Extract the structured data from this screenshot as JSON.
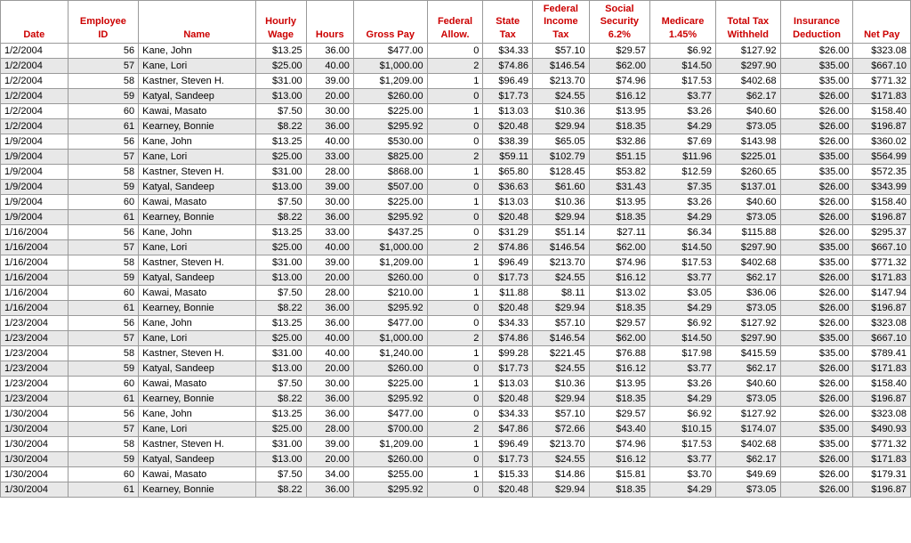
{
  "table": {
    "headers": [
      {
        "id": "date",
        "lines": [
          "Date"
        ],
        "align": "left"
      },
      {
        "id": "emp_id",
        "lines": [
          "Employee",
          "ID"
        ],
        "align": "right"
      },
      {
        "id": "name",
        "lines": [
          "Name"
        ],
        "align": "left"
      },
      {
        "id": "hourly_wage",
        "lines": [
          "Hourly",
          "Wage"
        ],
        "align": "right"
      },
      {
        "id": "hours",
        "lines": [
          "Hours"
        ],
        "align": "right"
      },
      {
        "id": "gross_pay",
        "lines": [
          "Gross Pay"
        ],
        "align": "right"
      },
      {
        "id": "fed_allow",
        "lines": [
          "Federal",
          "Allow."
        ],
        "align": "right"
      },
      {
        "id": "state_tax",
        "lines": [
          "State",
          "Tax"
        ],
        "align": "right"
      },
      {
        "id": "fed_income_tax",
        "lines": [
          "Federal",
          "Income",
          "Tax"
        ],
        "align": "right"
      },
      {
        "id": "social_security",
        "lines": [
          "Social",
          "Security",
          "6.2%"
        ],
        "align": "right"
      },
      {
        "id": "medicare",
        "lines": [
          "Medicare",
          "1.45%"
        ],
        "align": "right"
      },
      {
        "id": "total_tax_withheld",
        "lines": [
          "Total Tax",
          "Withheld"
        ],
        "align": "right"
      },
      {
        "id": "insurance_deduction",
        "lines": [
          "Insurance",
          "Deduction"
        ],
        "align": "right"
      },
      {
        "id": "net_pay",
        "lines": [
          "Net Pay"
        ],
        "align": "right"
      }
    ],
    "rows": [
      [
        "1/2/2004",
        "56",
        "Kane, John",
        "$13.25",
        "36.00",
        "$477.00",
        "0",
        "$34.33",
        "$57.10",
        "$29.57",
        "$6.92",
        "$127.92",
        "$26.00",
        "$323.08"
      ],
      [
        "1/2/2004",
        "57",
        "Kane, Lori",
        "$25.00",
        "40.00",
        "$1,000.00",
        "2",
        "$74.86",
        "$146.54",
        "$62.00",
        "$14.50",
        "$297.90",
        "$35.00",
        "$667.10"
      ],
      [
        "1/2/2004",
        "58",
        "Kastner, Steven H.",
        "$31.00",
        "39.00",
        "$1,209.00",
        "1",
        "$96.49",
        "$213.70",
        "$74.96",
        "$17.53",
        "$402.68",
        "$35.00",
        "$771.32"
      ],
      [
        "1/2/2004",
        "59",
        "Katyal, Sandeep",
        "$13.00",
        "20.00",
        "$260.00",
        "0",
        "$17.73",
        "$24.55",
        "$16.12",
        "$3.77",
        "$62.17",
        "$26.00",
        "$171.83"
      ],
      [
        "1/2/2004",
        "60",
        "Kawai, Masato",
        "$7.50",
        "30.00",
        "$225.00",
        "1",
        "$13.03",
        "$10.36",
        "$13.95",
        "$3.26",
        "$40.60",
        "$26.00",
        "$158.40"
      ],
      [
        "1/2/2004",
        "61",
        "Kearney, Bonnie",
        "$8.22",
        "36.00",
        "$295.92",
        "0",
        "$20.48",
        "$29.94",
        "$18.35",
        "$4.29",
        "$73.05",
        "$26.00",
        "$196.87"
      ],
      [
        "1/9/2004",
        "56",
        "Kane, John",
        "$13.25",
        "40.00",
        "$530.00",
        "0",
        "$38.39",
        "$65.05",
        "$32.86",
        "$7.69",
        "$143.98",
        "$26.00",
        "$360.02"
      ],
      [
        "1/9/2004",
        "57",
        "Kane, Lori",
        "$25.00",
        "33.00",
        "$825.00",
        "2",
        "$59.11",
        "$102.79",
        "$51.15",
        "$11.96",
        "$225.01",
        "$35.00",
        "$564.99"
      ],
      [
        "1/9/2004",
        "58",
        "Kastner, Steven H.",
        "$31.00",
        "28.00",
        "$868.00",
        "1",
        "$65.80",
        "$128.45",
        "$53.82",
        "$12.59",
        "$260.65",
        "$35.00",
        "$572.35"
      ],
      [
        "1/9/2004",
        "59",
        "Katyal, Sandeep",
        "$13.00",
        "39.00",
        "$507.00",
        "0",
        "$36.63",
        "$61.60",
        "$31.43",
        "$7.35",
        "$137.01",
        "$26.00",
        "$343.99"
      ],
      [
        "1/9/2004",
        "60",
        "Kawai, Masato",
        "$7.50",
        "30.00",
        "$225.00",
        "1",
        "$13.03",
        "$10.36",
        "$13.95",
        "$3.26",
        "$40.60",
        "$26.00",
        "$158.40"
      ],
      [
        "1/9/2004",
        "61",
        "Kearney, Bonnie",
        "$8.22",
        "36.00",
        "$295.92",
        "0",
        "$20.48",
        "$29.94",
        "$18.35",
        "$4.29",
        "$73.05",
        "$26.00",
        "$196.87"
      ],
      [
        "1/16/2004",
        "56",
        "Kane, John",
        "$13.25",
        "33.00",
        "$437.25",
        "0",
        "$31.29",
        "$51.14",
        "$27.11",
        "$6.34",
        "$115.88",
        "$26.00",
        "$295.37"
      ],
      [
        "1/16/2004",
        "57",
        "Kane, Lori",
        "$25.00",
        "40.00",
        "$1,000.00",
        "2",
        "$74.86",
        "$146.54",
        "$62.00",
        "$14.50",
        "$297.90",
        "$35.00",
        "$667.10"
      ],
      [
        "1/16/2004",
        "58",
        "Kastner, Steven H.",
        "$31.00",
        "39.00",
        "$1,209.00",
        "1",
        "$96.49",
        "$213.70",
        "$74.96",
        "$17.53",
        "$402.68",
        "$35.00",
        "$771.32"
      ],
      [
        "1/16/2004",
        "59",
        "Katyal, Sandeep",
        "$13.00",
        "20.00",
        "$260.00",
        "0",
        "$17.73",
        "$24.55",
        "$16.12",
        "$3.77",
        "$62.17",
        "$26.00",
        "$171.83"
      ],
      [
        "1/16/2004",
        "60",
        "Kawai, Masato",
        "$7.50",
        "28.00",
        "$210.00",
        "1",
        "$11.88",
        "$8.11",
        "$13.02",
        "$3.05",
        "$36.06",
        "$26.00",
        "$147.94"
      ],
      [
        "1/16/2004",
        "61",
        "Kearney, Bonnie",
        "$8.22",
        "36.00",
        "$295.92",
        "0",
        "$20.48",
        "$29.94",
        "$18.35",
        "$4.29",
        "$73.05",
        "$26.00",
        "$196.87"
      ],
      [
        "1/23/2004",
        "56",
        "Kane, John",
        "$13.25",
        "36.00",
        "$477.00",
        "0",
        "$34.33",
        "$57.10",
        "$29.57",
        "$6.92",
        "$127.92",
        "$26.00",
        "$323.08"
      ],
      [
        "1/23/2004",
        "57",
        "Kane, Lori",
        "$25.00",
        "40.00",
        "$1,000.00",
        "2",
        "$74.86",
        "$146.54",
        "$62.00",
        "$14.50",
        "$297.90",
        "$35.00",
        "$667.10"
      ],
      [
        "1/23/2004",
        "58",
        "Kastner, Steven H.",
        "$31.00",
        "40.00",
        "$1,240.00",
        "1",
        "$99.28",
        "$221.45",
        "$76.88",
        "$17.98",
        "$415.59",
        "$35.00",
        "$789.41"
      ],
      [
        "1/23/2004",
        "59",
        "Katyal, Sandeep",
        "$13.00",
        "20.00",
        "$260.00",
        "0",
        "$17.73",
        "$24.55",
        "$16.12",
        "$3.77",
        "$62.17",
        "$26.00",
        "$171.83"
      ],
      [
        "1/23/2004",
        "60",
        "Kawai, Masato",
        "$7.50",
        "30.00",
        "$225.00",
        "1",
        "$13.03",
        "$10.36",
        "$13.95",
        "$3.26",
        "$40.60",
        "$26.00",
        "$158.40"
      ],
      [
        "1/23/2004",
        "61",
        "Kearney, Bonnie",
        "$8.22",
        "36.00",
        "$295.92",
        "0",
        "$20.48",
        "$29.94",
        "$18.35",
        "$4.29",
        "$73.05",
        "$26.00",
        "$196.87"
      ],
      [
        "1/30/2004",
        "56",
        "Kane, John",
        "$13.25",
        "36.00",
        "$477.00",
        "0",
        "$34.33",
        "$57.10",
        "$29.57",
        "$6.92",
        "$127.92",
        "$26.00",
        "$323.08"
      ],
      [
        "1/30/2004",
        "57",
        "Kane, Lori",
        "$25.00",
        "28.00",
        "$700.00",
        "2",
        "$47.86",
        "$72.66",
        "$43.40",
        "$10.15",
        "$174.07",
        "$35.00",
        "$490.93"
      ],
      [
        "1/30/2004",
        "58",
        "Kastner, Steven H.",
        "$31.00",
        "39.00",
        "$1,209.00",
        "1",
        "$96.49",
        "$213.70",
        "$74.96",
        "$17.53",
        "$402.68",
        "$35.00",
        "$771.32"
      ],
      [
        "1/30/2004",
        "59",
        "Katyal, Sandeep",
        "$13.00",
        "20.00",
        "$260.00",
        "0",
        "$17.73",
        "$24.55",
        "$16.12",
        "$3.77",
        "$62.17",
        "$26.00",
        "$171.83"
      ],
      [
        "1/30/2004",
        "60",
        "Kawai, Masato",
        "$7.50",
        "34.00",
        "$255.00",
        "1",
        "$15.33",
        "$14.86",
        "$15.81",
        "$3.70",
        "$49.69",
        "$26.00",
        "$179.31"
      ],
      [
        "1/30/2004",
        "61",
        "Kearney, Bonnie",
        "$8.22",
        "36.00",
        "$295.92",
        "0",
        "$20.48",
        "$29.94",
        "$18.35",
        "$4.29",
        "$73.05",
        "$26.00",
        "$196.87"
      ]
    ]
  }
}
